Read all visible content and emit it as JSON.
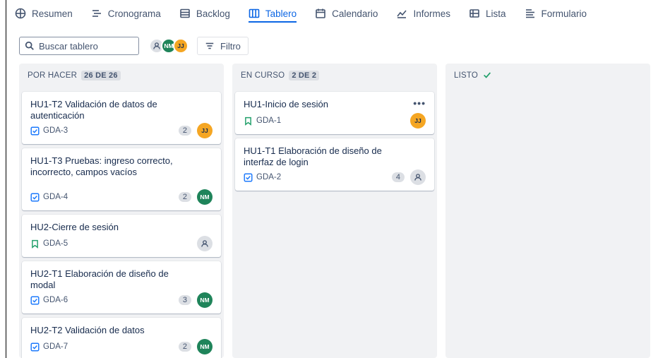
{
  "tabs": [
    {
      "label": "Resumen",
      "icon": "globe-icon"
    },
    {
      "label": "Cronograma",
      "icon": "timeline-icon"
    },
    {
      "label": "Backlog",
      "icon": "backlog-icon"
    },
    {
      "label": "Tablero",
      "icon": "board-icon",
      "active": true
    },
    {
      "label": "Calendario",
      "icon": "calendar-icon"
    },
    {
      "label": "Informes",
      "icon": "chart-icon"
    },
    {
      "label": "Lista",
      "icon": "list-icon"
    },
    {
      "label": "Formulario",
      "icon": "form-icon"
    }
  ],
  "toolbar": {
    "search_placeholder": "Buscar tablero",
    "avatar_nm": "NM",
    "avatar_jj": "JJ",
    "filter_label": "Filtro"
  },
  "columns": [
    {
      "title": "POR HACER",
      "count": "26 DE 26",
      "cards": [
        {
          "title": "HU1-T2 Validación de datos de autenticación",
          "key": "GDA-3",
          "type": "task",
          "points": "2",
          "assignee": "JJ"
        },
        {
          "title": "HU1-T3 Pruebas: ingreso correcto, incorrecto, campos vacíos",
          "key": "GDA-4",
          "type": "task",
          "points": "2",
          "assignee": "NM"
        },
        {
          "title": "HU2-Cierre de sesión",
          "key": "GDA-5",
          "type": "story",
          "points": "",
          "assignee": ""
        },
        {
          "title": "HU2-T1 Elaboración de diseño de modal",
          "key": "GDA-6",
          "type": "task",
          "points": "3",
          "assignee": "NM"
        },
        {
          "title": "HU2-T2 Validación de datos",
          "key": "GDA-7",
          "type": "task",
          "points": "2",
          "assignee": "NM"
        }
      ]
    },
    {
      "title": "EN CURSO",
      "count": "2 DE 2",
      "cards": [
        {
          "title": "HU1-Inicio de sesión",
          "key": "GDA-1",
          "type": "story",
          "points": "",
          "assignee": "JJ",
          "more": "•••"
        },
        {
          "title": "HU1-T1 Elaboración de diseño de interfaz de login",
          "key": "GDA-2",
          "type": "task",
          "points": "4",
          "assignee": ""
        }
      ]
    },
    {
      "title": "LISTO",
      "count": "",
      "cards": []
    }
  ],
  "colors": {
    "accent": "#0c66e4",
    "green_avatar": "#1f845a",
    "orange_avatar": "#f5a623",
    "column_bg": "#f1f2f4"
  }
}
